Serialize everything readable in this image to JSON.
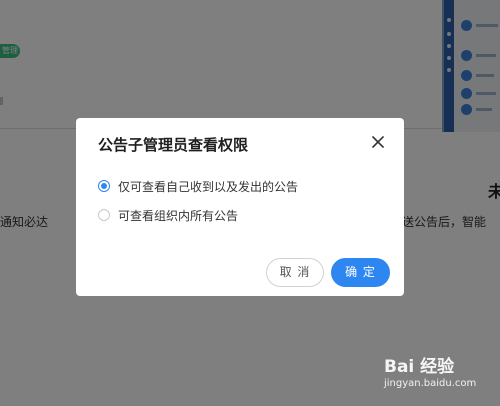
{
  "background": {
    "tag_text": "管理",
    "left_text": "通知必达",
    "right_title": "未",
    "right_text": "送公告后，智能"
  },
  "dialog": {
    "title": "公告子管理员查看权限",
    "close_icon": "close-icon",
    "options": [
      {
        "label": "仅可查看自己收到以及发出的公告",
        "checked": true
      },
      {
        "label": "可查看组织内所有公告",
        "checked": false
      }
    ],
    "cancel_label": "取 消",
    "confirm_label": "确 定"
  },
  "watermark": {
    "logo": "Bai 经验",
    "url": "jingyan.baidu.com"
  },
  "colors": {
    "accent": "#2e86f0",
    "overlay": "rgba(0,0,0,0.5)",
    "tag_green": "#3cbf83"
  }
}
